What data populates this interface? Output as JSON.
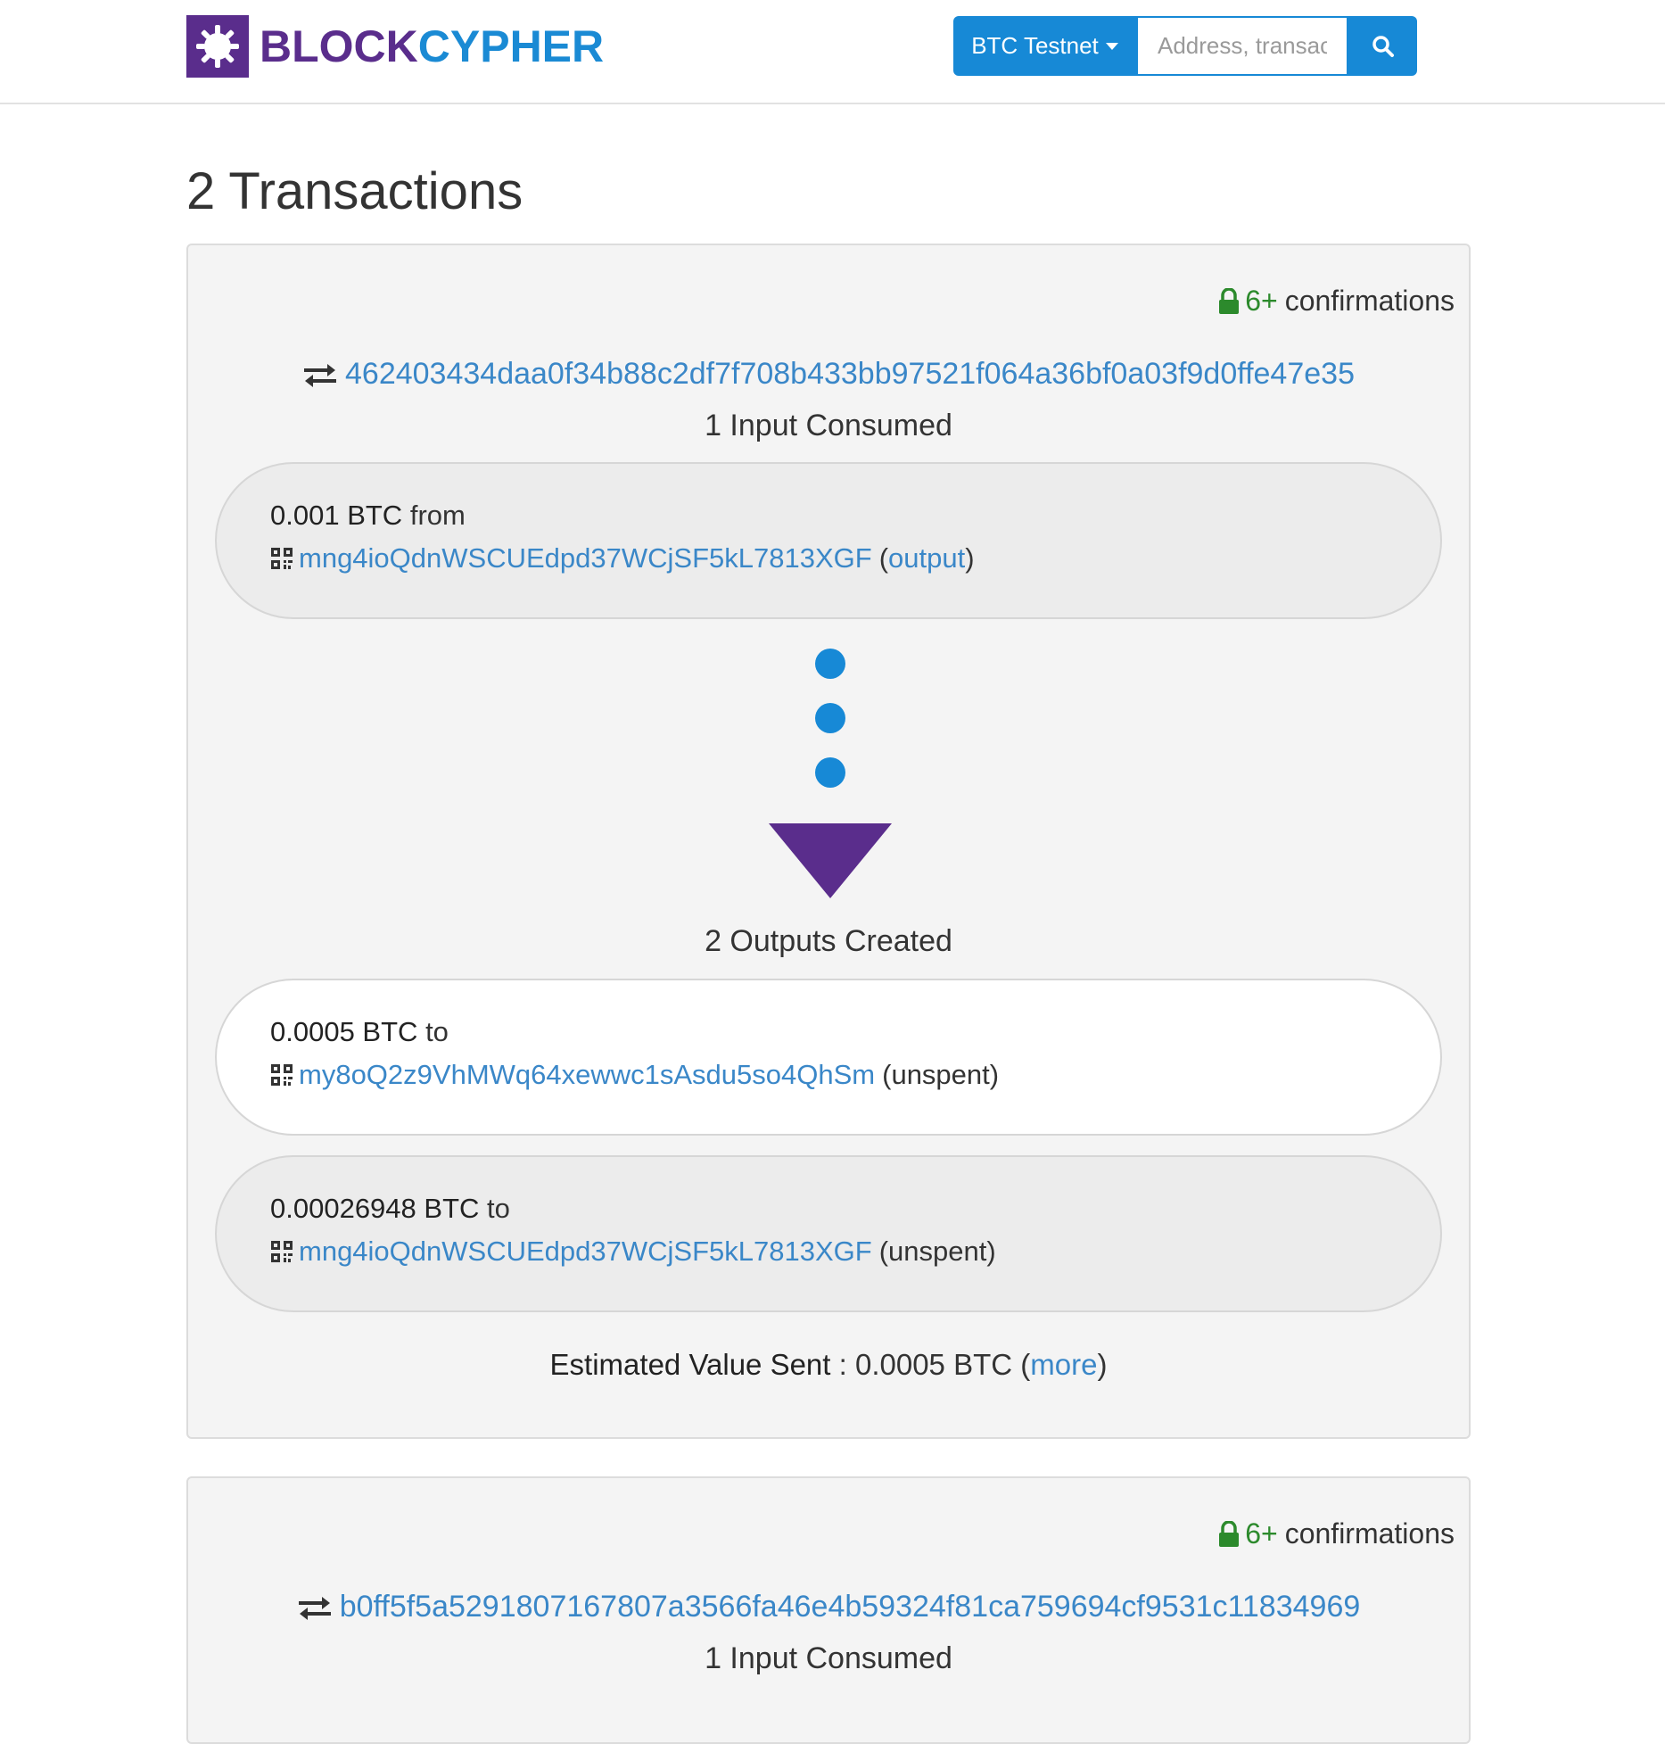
{
  "brand": {
    "name_part1": "BLOCK",
    "name_part2": "CYPHER",
    "colors": {
      "purple": "#5a2d8c",
      "blue": "#1a8ad4"
    }
  },
  "header": {
    "network_label": "BTC Testnet",
    "search_placeholder": "Address, transact",
    "search_icon": "search-icon"
  },
  "page": {
    "title": "2 Transactions"
  },
  "transactions": [
    {
      "confirmations_num": "6+",
      "confirmations_word": "confirmations",
      "hash": "462403434daa0f34b88c2df7f708b433bb97521f064a36bf0a03f9d0ffe47e35",
      "inputs_label": "1 Input Consumed",
      "inputs": [
        {
          "amount": "0.001 BTC",
          "direction": "from",
          "address": "mng4ioQdnWSCUEdpd37WCjSF5kL7813XGF",
          "paren_open": "(",
          "status": "output",
          "paren_close": ")"
        }
      ],
      "outputs_label": "2 Outputs Created",
      "outputs": [
        {
          "amount": "0.0005 BTC",
          "direction": "to",
          "address": "my8oQ2z9VhMWq64xewwc1sAsdu5so4QhSm",
          "status": "(unspent)"
        },
        {
          "amount": "0.00026948 BTC",
          "direction": "to",
          "address": "mng4ioQdnWSCUEdpd37WCjSF5kL7813XGF",
          "status": "(unspent)"
        }
      ],
      "estimate_label": "Estimated Value Sent",
      "estimate_sep": " : ",
      "estimate_value": "0.0005 BTC",
      "more_open": " (",
      "more_label": "more",
      "more_close": ")"
    },
    {
      "confirmations_num": "6+",
      "confirmations_word": "confirmations",
      "hash": "b0ff5f5a5291807167807a3566fa46e4b59324f81ca759694cf9531c11834969",
      "inputs_label": "1 Input Consumed"
    }
  ]
}
